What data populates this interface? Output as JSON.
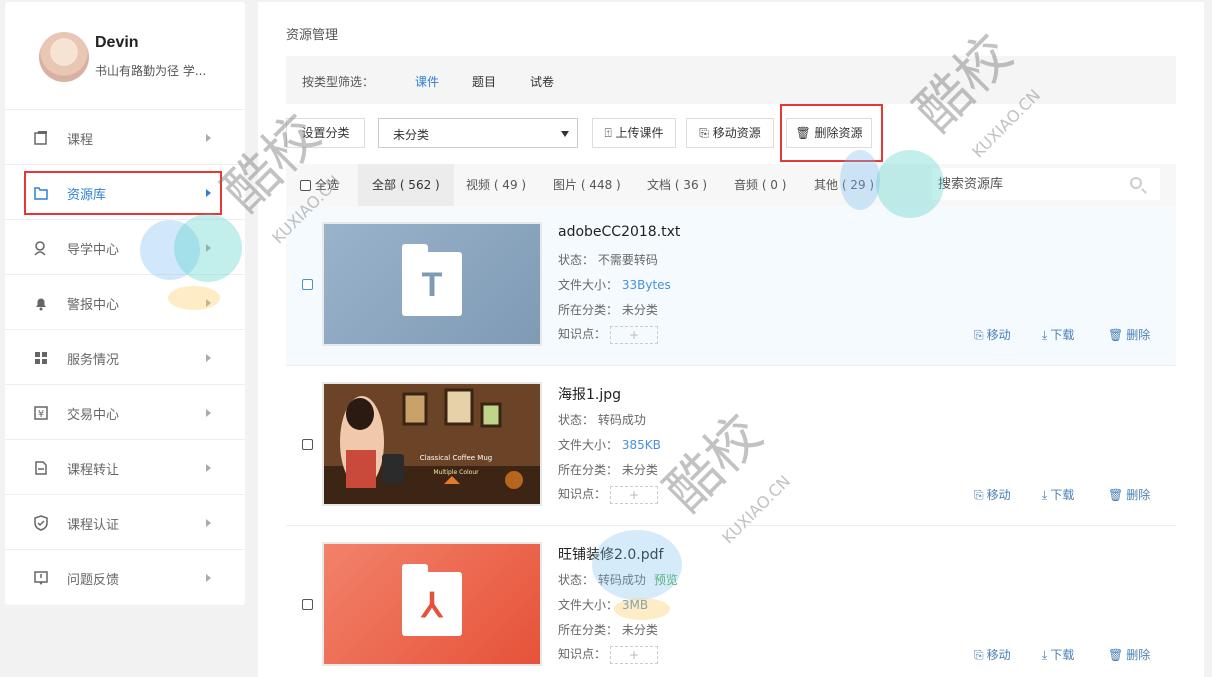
{
  "profile": {
    "name": "Devin",
    "motto": "书山有路勤为径 学..."
  },
  "sidebar": {
    "items": [
      {
        "label": "课程",
        "icon": "book-icon"
      },
      {
        "label": "资源库",
        "icon": "folder-icon"
      },
      {
        "label": "导学中心",
        "icon": "guide-icon"
      },
      {
        "label": "警报中心",
        "icon": "bell-icon"
      },
      {
        "label": "服务情况",
        "icon": "grid-icon"
      },
      {
        "label": "交易中心",
        "icon": "yen-icon"
      },
      {
        "label": "课程转让",
        "icon": "transfer-icon"
      },
      {
        "label": "课程认证",
        "icon": "shield-icon"
      },
      {
        "label": "问题反馈",
        "icon": "feedback-icon"
      }
    ],
    "active_index": 1
  },
  "main": {
    "title": "资源管理",
    "filter": {
      "label": "按类型筛选：",
      "options": [
        "课件",
        "题目",
        "试卷"
      ],
      "selected": "课件"
    },
    "toolbar": {
      "set_category": "设置分类",
      "category_value": "未分类",
      "upload": "上传课件",
      "move": "移动资源",
      "delete": "删除资源"
    },
    "tabs": {
      "select_all": "全选",
      "items": [
        "全部 ( 562 )",
        "视频 ( 49 )",
        "图片 ( 448 )",
        "文档 ( 36 )",
        "音频 ( 0 )",
        "其他 ( 29 )"
      ],
      "selected": "全部 ( 562 )"
    },
    "search": {
      "placeholder": "搜索资源库"
    },
    "labels": {
      "status": "状态：",
      "size": "文件大小：",
      "category": "所在分类：",
      "knowledge": "知识点：",
      "plus": "+",
      "move": "移动",
      "download": "下载",
      "delete": "删除"
    },
    "files": [
      {
        "name": "adobeCC2018.txt",
        "status": "不需要转码",
        "preview": "",
        "size": "33Bytes",
        "category": "未分类",
        "thumb_type": "text",
        "glyph": "T"
      },
      {
        "name": "海报1.jpg",
        "status": "转码成功",
        "preview": "",
        "size": "385KB",
        "category": "未分类",
        "thumb_type": "image",
        "poster_title": "Classical Coffee Mug",
        "poster_sub": "Multiple Colour"
      },
      {
        "name": "旺铺装修2.0.pdf",
        "status": "转码成功",
        "preview": "预览",
        "size": "3MB",
        "category": "未分类",
        "thumb_type": "pdf",
        "glyph": "⅄"
      }
    ]
  },
  "watermark": {
    "cn": "酷校",
    "en": "KUXIAO.CN"
  },
  "colors": {
    "accent": "#2f7fd8",
    "highlight": "#e53935",
    "txt_thumb": "#8fa9c2",
    "pdf_thumb": "#ee6a4f"
  }
}
